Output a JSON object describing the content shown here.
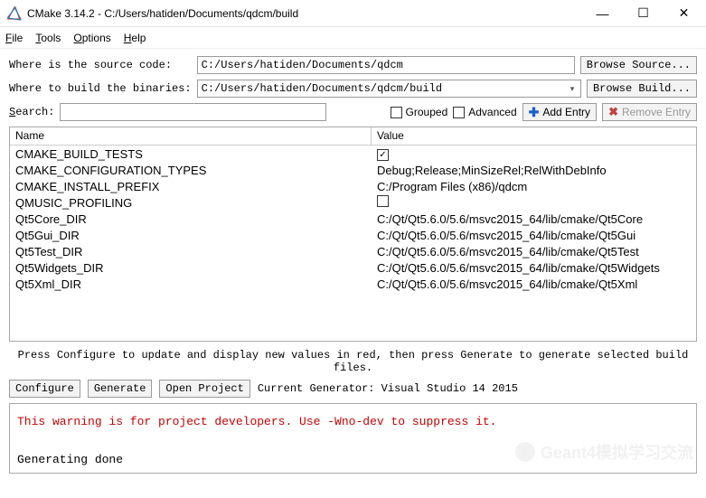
{
  "window": {
    "title": "CMake 3.14.2 - C:/Users/hatiden/Documents/qdcm/build"
  },
  "menu": {
    "file": "File",
    "tools": "Tools",
    "options": "Options",
    "help": "Help"
  },
  "labels": {
    "source": "Where is the source code:   ",
    "binaries": "Where to build the binaries:",
    "search": "Search:",
    "browse_source": "Browse Source...",
    "browse_build": "Browse Build...",
    "grouped": "Grouped",
    "advanced": "Advanced",
    "add_entry": "Add Entry",
    "remove_entry": "Remove Entry",
    "col_name": "Name",
    "col_value": "Value",
    "hint": "Press Configure to update and display new values in red, then press Generate to generate selected build files.",
    "configure": "Configure",
    "generate": "Generate",
    "open_project": "Open Project",
    "current_generator": "Current Generator: Visual Studio 14 2015"
  },
  "paths": {
    "source": "C:/Users/hatiden/Documents/qdcm",
    "build": "C:/Users/hatiden/Documents/qdcm/build"
  },
  "cache": [
    {
      "name": "CMAKE_BUILD_TESTS",
      "value": "",
      "checkbox": true,
      "checked": true
    },
    {
      "name": "CMAKE_CONFIGURATION_TYPES",
      "value": "Debug;Release;MinSizeRel;RelWithDebInfo"
    },
    {
      "name": "CMAKE_INSTALL_PREFIX",
      "value": "C:/Program Files (x86)/qdcm"
    },
    {
      "name": "QMUSIC_PROFILING",
      "value": "",
      "checkbox": true,
      "checked": false
    },
    {
      "name": "Qt5Core_DIR",
      "value": "C:/Qt/Qt5.6.0/5.6/msvc2015_64/lib/cmake/Qt5Core"
    },
    {
      "name": "Qt5Gui_DIR",
      "value": "C:/Qt/Qt5.6.0/5.6/msvc2015_64/lib/cmake/Qt5Gui"
    },
    {
      "name": "Qt5Test_DIR",
      "value": "C:/Qt/Qt5.6.0/5.6/msvc2015_64/lib/cmake/Qt5Test"
    },
    {
      "name": "Qt5Widgets_DIR",
      "value": "C:/Qt/Qt5.6.0/5.6/msvc2015_64/lib/cmake/Qt5Widgets"
    },
    {
      "name": "Qt5Xml_DIR",
      "value": "C:/Qt/Qt5.6.0/5.6/msvc2015_64/lib/cmake/Qt5Xml"
    }
  ],
  "log": {
    "warning": "This warning is for project developers.  Use -Wno-dev to suppress it.",
    "done": "Generating done"
  },
  "watermark": "Geant4模拟学习交流"
}
